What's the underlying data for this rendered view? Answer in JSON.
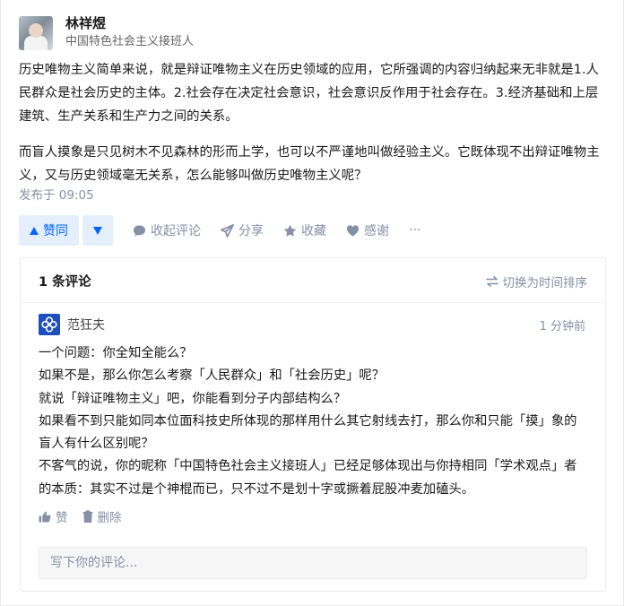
{
  "author": {
    "name": "林祥煜",
    "bio": "中国特色社会主义接班人"
  },
  "answer": {
    "paragraphs": [
      "历史唯物主义简单来说，就是辩证唯物主义在历史领域的应用，它所强调的内容归纳起来无非就是1.人民群众是社会历史的主体。2.社会存在决定社会意识，社会意识反作用于社会存在。3.经济基础和上层建筑、生产关系和生产力之间的关系。",
      "而盲人摸象是只见树木不见森林的形而上学，也可以不严谨地叫做经验主义。它既体现不出辩证唯物主义，又与历史领域毫无关系，怎么能够叫做历史唯物主义呢？"
    ],
    "published": "发布于 09:05"
  },
  "actions": {
    "upvote": "赞同",
    "collapse_comments": "收起评论",
    "share": "分享",
    "favorite": "收藏",
    "thanks": "感谢",
    "more": "···"
  },
  "comments": {
    "count": "1 条评论",
    "sort": "切换为时间排序",
    "items": [
      {
        "user": "范狂夫",
        "time": "1 分钟前",
        "lines": [
          "一个问题：你全知全能么？",
          "如果不是，那么你怎么考察「人民群众」和「社会历史」呢？",
          "就说「辩证唯物主义」吧，你能看到分子内部结构么？",
          "如果看不到只能如同本位面科技史所体现的那样用什么其它射线去打，那么你和只能「摸」象的盲人有什么区别呢？",
          "不客气的说，你的昵称「中国特色社会主义接班人」已经足够体现出与你持相同「学术观点」者的本质：其实不过是个神棍而已，只不过不是划十字或撅着屁股冲麦加磕头。"
        ],
        "like": "赞",
        "delete": "删除"
      }
    ],
    "input_placeholder": "写下你的评论..."
  },
  "colors": {
    "accent": "#0066ff",
    "accent_bg": "#e5eefb",
    "muted": "#8590a6"
  }
}
